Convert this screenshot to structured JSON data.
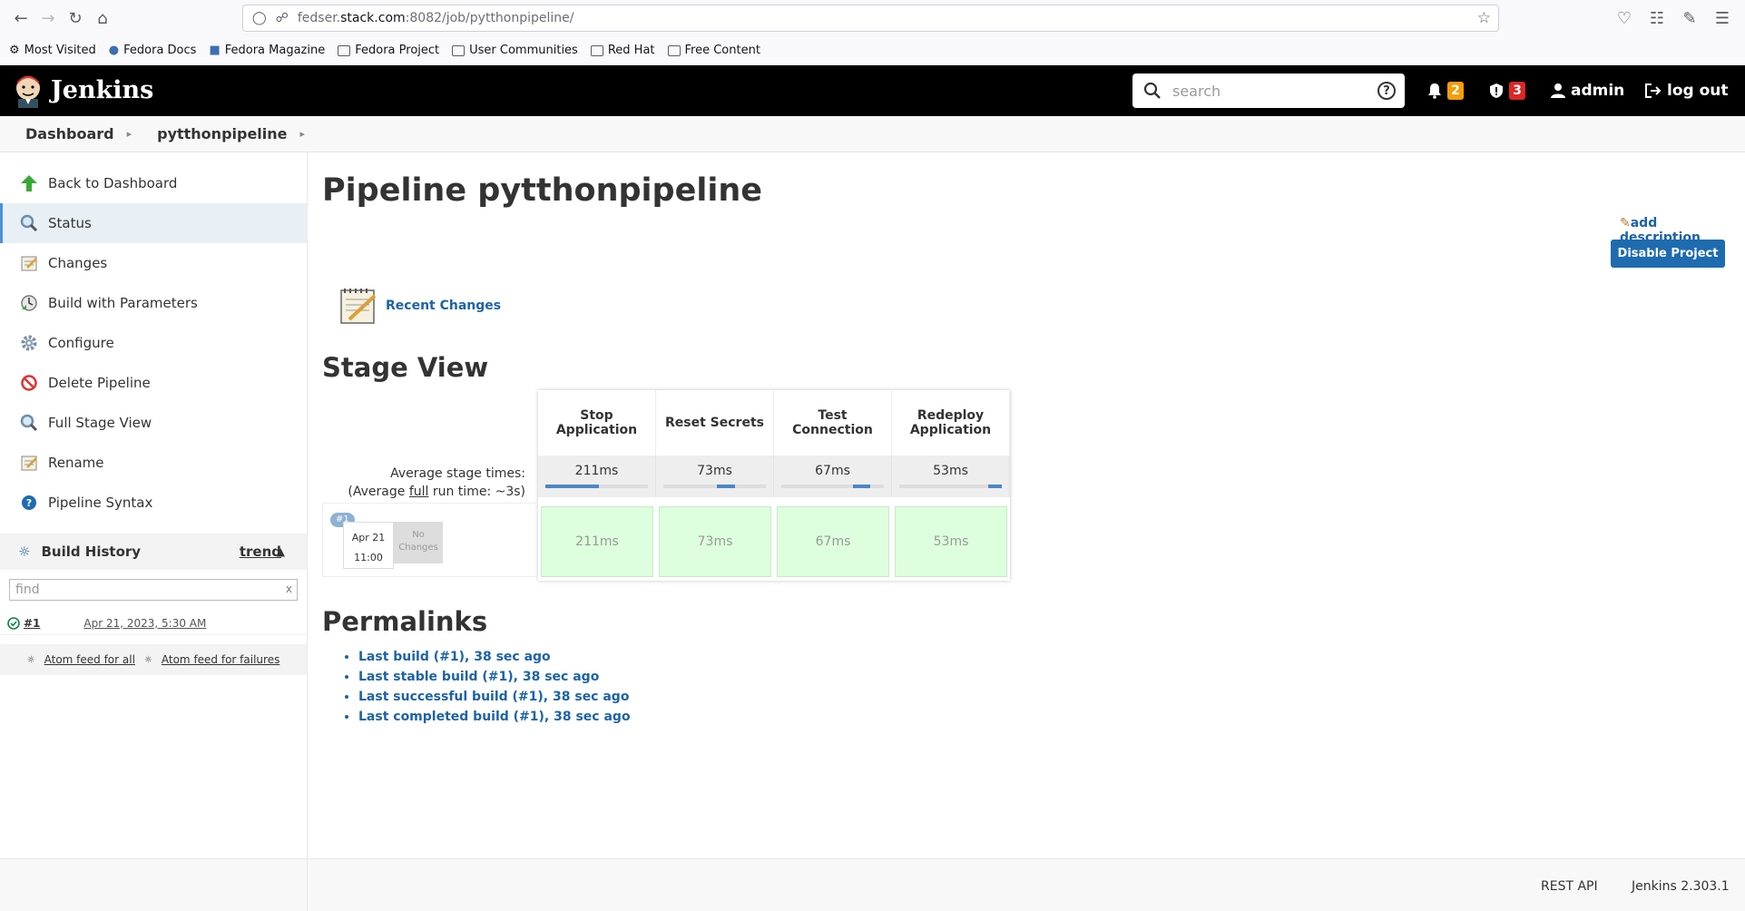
{
  "browser": {
    "url_prefix": "fedser.",
    "url_host": "stack.com",
    "url_rest": ":8082/job/pytthonpipeline/",
    "bookmarks": [
      "Most Visited",
      "Fedora Docs",
      "Fedora Magazine",
      "Fedora Project",
      "User Communities",
      "Red Hat",
      "Free Content"
    ]
  },
  "header": {
    "app_title": "Jenkins",
    "search_placeholder": "search",
    "notifications_count": "2",
    "security_count": "3",
    "user": "admin",
    "logout": "log out",
    "colors": {
      "notify": "#f59e0b",
      "security": "#dc2626"
    }
  },
  "breadcrumb": [
    "Dashboard",
    "pytthonpipeline"
  ],
  "sidebar": {
    "items": [
      {
        "label": "Back to Dashboard",
        "icon": "up-arrow-icon"
      },
      {
        "label": "Status",
        "icon": "magnifier-icon"
      },
      {
        "label": "Changes",
        "icon": "notepad-icon"
      },
      {
        "label": "Build with Parameters",
        "icon": "clock-build-icon"
      },
      {
        "label": "Configure",
        "icon": "gear-icon"
      },
      {
        "label": "Delete Pipeline",
        "icon": "no-entry-icon"
      },
      {
        "label": "Full Stage View",
        "icon": "magnifier-icon"
      },
      {
        "label": "Rename",
        "icon": "notepad-icon"
      },
      {
        "label": "Pipeline Syntax",
        "icon": "help-icon"
      }
    ],
    "build_history": {
      "title": "Build History",
      "trend": "trend",
      "find_placeholder": "find",
      "clear": "x",
      "builds": [
        {
          "number": "#1",
          "date": "Apr 21, 2023, 5:30 AM"
        }
      ],
      "feed_all": "Atom feed for all",
      "feed_failures": "Atom feed for failures"
    }
  },
  "main": {
    "title": "Pipeline pytthonpipeline",
    "add_description": "add description",
    "disable_button": "Disable Project",
    "recent_changes": "Recent Changes",
    "stage_view_title": "Stage View",
    "avg_label_1": "Average stage times:",
    "avg_label_2a": "(Average ",
    "avg_label_2b": "full",
    "avg_label_2c": " run time: ~3s)",
    "run": {
      "badge": "#1",
      "date": "Apr 21",
      "time": "11:00",
      "no_changes": "No Changes"
    },
    "stages": [
      {
        "name": "Stop Application",
        "avg": "211ms",
        "run": "211ms",
        "bar_start": 0.0,
        "bar_fraction": 0.52
      },
      {
        "name": "Reset Secrets",
        "avg": "73ms",
        "run": "73ms",
        "bar_start": 0.52,
        "bar_fraction": 0.18
      },
      {
        "name": "Test Connection",
        "avg": "67ms",
        "run": "67ms",
        "bar_start": 0.7,
        "bar_fraction": 0.17
      },
      {
        "name": "Redeploy Application",
        "avg": "53ms",
        "run": "53ms",
        "bar_start": 0.87,
        "bar_fraction": 0.13
      }
    ],
    "permalinks_title": "Permalinks",
    "permalinks": [
      "Last build (#1), 38 sec ago",
      "Last stable build (#1), 38 sec ago",
      "Last successful build (#1), 38 sec ago",
      "Last completed build (#1), 38 sec ago"
    ]
  },
  "footer": {
    "rest_api": "REST API",
    "version": "Jenkins 2.303.1"
  }
}
